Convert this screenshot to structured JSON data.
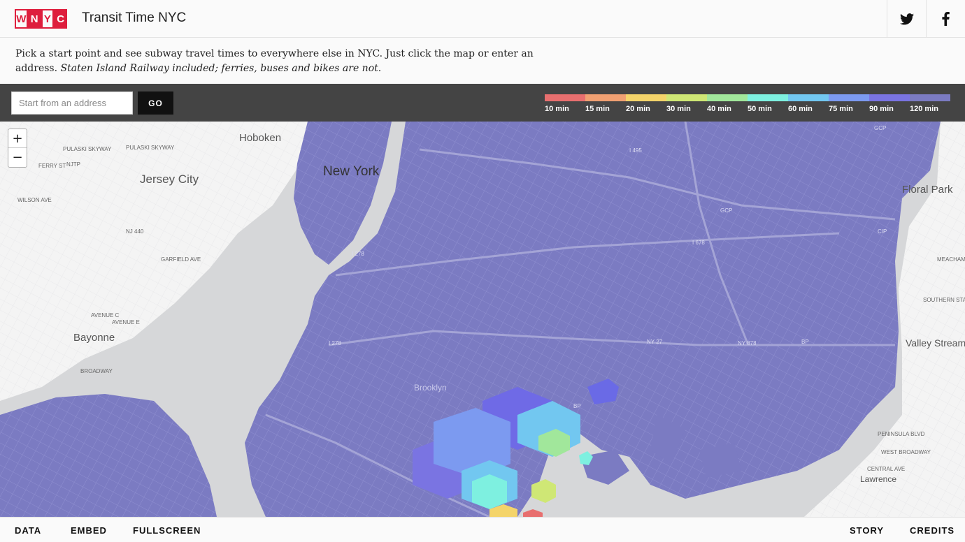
{
  "header": {
    "logo_letters": [
      "W",
      "N",
      "Y",
      "C"
    ],
    "title": "Transit Time NYC",
    "social": [
      {
        "name": "twitter-icon"
      },
      {
        "name": "facebook-icon"
      }
    ]
  },
  "intro": {
    "text": "Pick a start point and see subway travel times to everywhere else in NYC. Just click the map or enter an address.",
    "note": "Staten Island Railway included; ferries, buses and bikes are not."
  },
  "controls": {
    "address_placeholder": "Start from an address",
    "go_label": "GO"
  },
  "legend": [
    {
      "label": "10 min",
      "color": "#e86f6f"
    },
    {
      "label": "15 min",
      "color": "#f0a072"
    },
    {
      "label": "20 min",
      "color": "#f4d46a"
    },
    {
      "label": "30 min",
      "color": "#cfe775"
    },
    {
      "label": "40 min",
      "color": "#a1e79b"
    },
    {
      "label": "50 min",
      "color": "#7ef0e0"
    },
    {
      "label": "60 min",
      "color": "#72c7f0"
    },
    {
      "label": "75 min",
      "color": "#7c9af0"
    },
    {
      "label": "90 min",
      "color": "#7a74e2"
    },
    {
      "label": "120 min",
      "color": "#7b7bc2"
    }
  ],
  "map": {
    "places": [
      "Hoboken",
      "New York",
      "Jersey City",
      "Bayonne",
      "Floral Park",
      "Valley Stream",
      "Lawrence",
      "Brooklyn"
    ],
    "roads": [
      "PULASKI SKYWAY",
      "PULASKI SKYWAY",
      "FERRY ST",
      "NJTP",
      "WILSON AVE",
      "NJ 440",
      "GARFIELD AVE",
      "AVENUE C",
      "AVENUE E",
      "BROADWAY",
      "I 278",
      "I 495",
      "I 678",
      "I 278",
      "GCP",
      "GCP",
      "CIP",
      "NY 27",
      "NY 878",
      "BP",
      "BP",
      "PENINSULA BLVD",
      "WEST BROADWAY",
      "CENTRAL AVE",
      "MEACHAM AVE",
      "SOUTHERN STATE"
    ],
    "zoom_in": "+",
    "zoom_out": "−"
  },
  "footer": {
    "left": [
      "DATA",
      "EMBED",
      "FULLSCREEN"
    ],
    "right": [
      "STORY",
      "CREDITS"
    ]
  }
}
